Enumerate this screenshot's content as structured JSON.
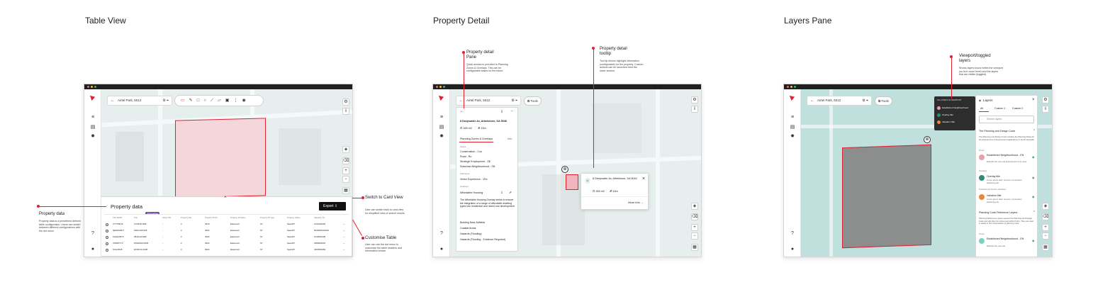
{
  "sections": {
    "table_view": "Table View",
    "property_detail": "Property Detail",
    "layers_pane": "Layers Pane"
  },
  "colors": {
    "accent_red": "#e02030",
    "titlebar": "#1f1f1f",
    "map_bg": "#e7efee",
    "highlight_red_fill": "#f4d7da",
    "layer_teal": "#bfe0dc",
    "parcel_gray": "#8b8e8d"
  },
  "search": {
    "address": "Airtel Park, 5012"
  },
  "table_view": {
    "panel_title": "Property data",
    "badge": "4 Properties",
    "export_label": "Export",
    "columns": [
      "Title Ref/ID",
      "Title",
      "Street Nbr",
      "Property Nbr",
      "Property ID No",
      "Property ID Name",
      "Property ID Type",
      "Property Status",
      "Valuation No"
    ],
    "rows": [
      [
        "CT7769/15",
        "CT3374/1305",
        "-",
        "2",
        "3910",
        "Easement",
        "ST",
        "SearAPI",
        "1341320025"
      ],
      [
        "QE0403AFT",
        "S40CO4/1305",
        "-",
        "2",
        "3944",
        "Easement",
        "ST",
        "SearAPI",
        "5432054444016"
      ],
      [
        "CH4410574",
        "2814/14/1305",
        "-",
        "2",
        "3944",
        "Easement",
        "ST",
        "SearAPI",
        "1443534408"
      ],
      [
        "V3S0PYTV",
        "WOHPHX/1305",
        "-",
        "2",
        "3944",
        "Easement",
        "ST",
        "SearAPI",
        "2389324634"
      ],
      [
        "SCH4IS15",
        "EXI3CCL/1305",
        "-",
        "2",
        "3944",
        "Easement",
        "ST",
        "SearAPI",
        "4344560383"
      ]
    ],
    "annotations": {
      "property_data_title": "Property data",
      "property_data_desc": "Property data is a predefined defined table configuration. Users can switch between different configurations with the dot menu",
      "switch_title": "Switch to Card View",
      "switch_desc": "User can switch back to card view for simplified view of search results",
      "customise_title": "Customise Table",
      "customise_desc": "User can use the dot menu to customize the table headers and information shown"
    }
  },
  "property_detail": {
    "tools_label": "Tools",
    "address": "8 Deepwater Av, Athelstone, SA 5040",
    "area": "165 m2",
    "frontage": "13m",
    "tab_active": "Planning Zones & Overlays",
    "tab_other": "Info",
    "group_zones": "Zones",
    "zones": [
      "Conservation - Con",
      "Rural - Ru",
      "Strategic Employment - SE",
      "Suburban Neighbourhood - SN"
    ],
    "group_subzones": "Subzones",
    "subzones": [
      "Visitor Experience - VEx"
    ],
    "group_overlays": "Overlays",
    "overlay_title": "Affordable Housing",
    "overlay_desc": "The Affordable Housing Overlay seeks to ensure the integration of a range of affordable dwelling types into residential and mixed use development.",
    "more_overlays": [
      "Building Near Airfields",
      "Coastal Areas",
      "Hazards (Flooding)",
      "Hazards (Flooding - Evidence Required)"
    ],
    "tooltip_address": "8 Deepwater Av, Athelstone, SA 5040",
    "tooltip_area": "165 m2",
    "tooltip_frontage": "13m",
    "tooltip_more": "More info",
    "annotations": {
      "pane_title": "Property detail Pane",
      "pane_desc": "Quick access is provided to Planning Zones & Overlays. This can be configurable based on the future",
      "tooltip_title": "Property detail tooltip",
      "tooltip_desc": "Tool tip shows highlight information (configurable) for the property. Custom actions can be launched from the lower section."
    }
  },
  "layers_pane": {
    "tools_label": "Tools",
    "legend_header": "SA LAYERS IN VIEWPORT",
    "legend_items": [
      "Established Neighbourhood",
      "Overlay title",
      "Variation Title"
    ],
    "layers_title": "Layers",
    "tabs": [
      "All",
      "Custom 1",
      "Custom 2"
    ],
    "search_placeholder": "Search layers",
    "group_1_title": "The Planning and Design Code",
    "group_1_desc": "The Planning and Design Code includes the Planning Rules for the assessment of development applications in South Australia.",
    "sub_zones": "Zones",
    "layer_1_title": "Established Neighbourhood - EN",
    "layer_1_desc": "Maintain the use and development of an area.",
    "sub_overlays": "Overlays",
    "layer_2_title": "Overlay title",
    "layer_2_desc": "Lorem ipsum dolor sit amet, consectetur adipiscing elit.",
    "sub_variations": "Technical and Numeric Variations",
    "layer_3_title": "Variation title",
    "layer_3_desc": "Lorem ipsum dolor sit amet, consectetur adipiscing elit.",
    "group_2_title": "Planning Code Reference Layers",
    "group_2_desc": "Planning Reference Layers support the Planning and Design Code and will often be referenced within Policy. They are used to assist in the interpretation of planning rules.",
    "sub_zones_2": "Zones",
    "layer_4_title": "Established Neighbourhood - EN",
    "layer_4_desc": "Maintain the use and",
    "annotations": {
      "viewport_title": "Viewport/toggled layers",
      "viewport_desc": "Shows layers found within the viewport (so isn't zoom level) and the layers that are visible (toggled)"
    }
  }
}
